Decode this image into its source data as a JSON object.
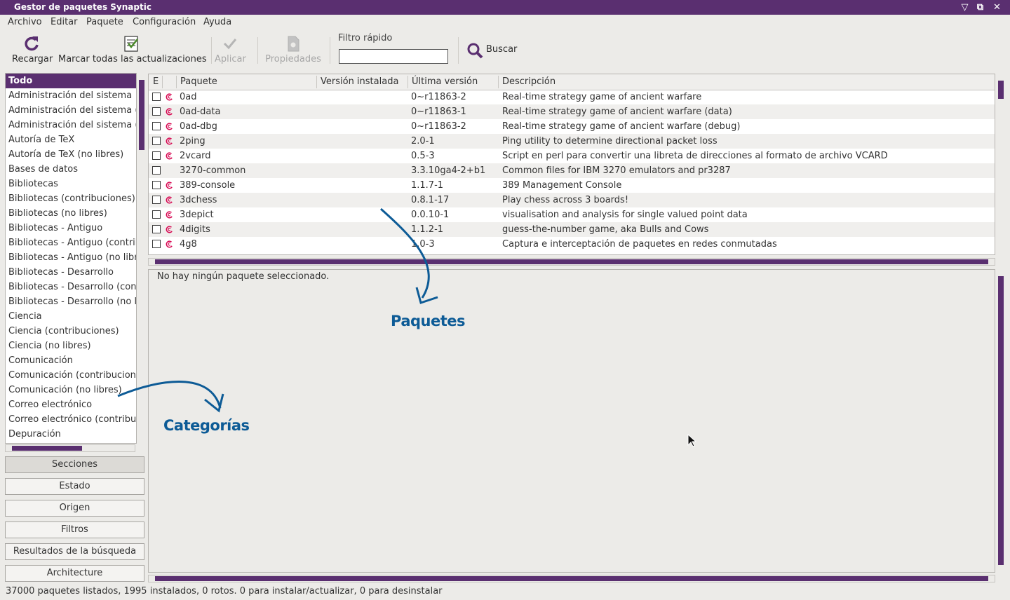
{
  "window": {
    "title": "Gestor de paquetes Synaptic"
  },
  "menu": [
    "Archivo",
    "Editar",
    "Paquete",
    "Configuración",
    "Ayuda"
  ],
  "toolbar": {
    "reload": "Recargar",
    "mark_all": "Marcar todas las actualizaciones",
    "apply": "Aplicar",
    "properties": "Propiedades",
    "filter_label": "Filtro rápido",
    "filter_value": "",
    "search": "Buscar"
  },
  "categories": [
    "Todo",
    "Administración del sistema",
    "Administración del sistema (",
    "Administración del sistema (",
    "Autoría de TeX",
    "Autoría de TeX (no libres)",
    "Bases de datos",
    "Bibliotecas",
    "Bibliotecas (contribuciones)",
    "Bibliotecas (no libres)",
    "Bibliotecas - Antiguo",
    "Bibliotecas - Antiguo (contrib",
    "Bibliotecas - Antiguo (no libr",
    "Bibliotecas - Desarrollo",
    "Bibliotecas - Desarrollo (con",
    "Bibliotecas - Desarrollo (no li",
    "Ciencia",
    "Ciencia (contribuciones)",
    "Ciencia (no libres)",
    "Comunicación",
    "Comunicación (contribucione",
    "Comunicación (no libres)",
    "Correo electrónico",
    "Correo electrónico (contribu",
    "Depuración"
  ],
  "side_buttons": [
    "Secciones",
    "Estado",
    "Origen",
    "Filtros",
    "Resultados de la búsqueda",
    "Architecture"
  ],
  "columns": {
    "e": "E",
    "package": "Paquete",
    "installed": "Versión instalada",
    "latest": "Última versión",
    "description": "Descripción"
  },
  "packages": [
    {
      "name": "0ad",
      "installed": "",
      "latest": "0~r11863-2",
      "desc": "Real-time strategy game of ancient warfare",
      "debian": true
    },
    {
      "name": "0ad-data",
      "installed": "",
      "latest": "0~r11863-1",
      "desc": "Real-time strategy game of ancient warfare (data)",
      "debian": true
    },
    {
      "name": "0ad-dbg",
      "installed": "",
      "latest": "0~r11863-2",
      "desc": "Real-time strategy game of ancient warfare (debug)",
      "debian": true
    },
    {
      "name": "2ping",
      "installed": "",
      "latest": "2.0-1",
      "desc": "Ping utility to determine directional packet loss",
      "debian": true
    },
    {
      "name": "2vcard",
      "installed": "",
      "latest": "0.5-3",
      "desc": "Script en perl para convertir una libreta de direcciones al formato de archivo VCARD",
      "debian": true
    },
    {
      "name": "3270-common",
      "installed": "",
      "latest": "3.3.10ga4-2+b1",
      "desc": "Common files for IBM 3270 emulators and pr3287",
      "debian": false
    },
    {
      "name": "389-console",
      "installed": "",
      "latest": "1.1.7-1",
      "desc": "389 Management Console",
      "debian": true
    },
    {
      "name": "3dchess",
      "installed": "",
      "latest": "0.8.1-17",
      "desc": "Play chess across 3 boards!",
      "debian": true
    },
    {
      "name": "3depict",
      "installed": "",
      "latest": "0.0.10-1",
      "desc": "visualisation and analysis for single valued point data",
      "debian": true
    },
    {
      "name": "4digits",
      "installed": "",
      "latest": "1.1.2-1",
      "desc": "guess-the-number game, aka Bulls and Cows",
      "debian": true
    },
    {
      "name": "4g8",
      "installed": "",
      "latest": "1.0-3",
      "desc": "Captura e interceptación de paquetes en redes conmutadas",
      "debian": true
    }
  ],
  "details": {
    "empty": "No hay ningún paquete seleccionado."
  },
  "annotations": {
    "packages": "Paquetes",
    "categories": "Categorías"
  },
  "status": "37000 paquetes listados, 1995 instalados, 0 rotos. 0 para instalar/actualizar, 0 para desinstalar",
  "colors": {
    "accent": "#5a2f70",
    "annotation": "#0d5b96",
    "debian": "#d70751"
  }
}
